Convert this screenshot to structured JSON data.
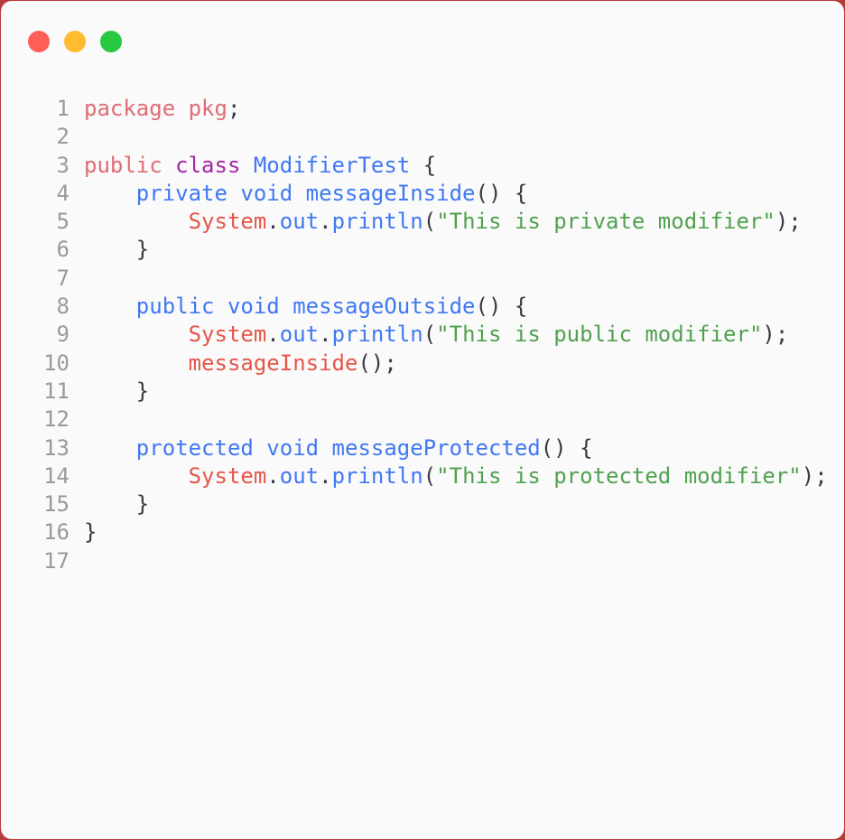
{
  "window": {
    "controls": [
      "close",
      "minimize",
      "maximize"
    ],
    "colors": {
      "background": "#fafafa",
      "close": "#ff5f57",
      "minimize": "#febc2e",
      "maximize": "#28c840"
    }
  },
  "editor": {
    "language": "java",
    "lines": [
      {
        "n": "1",
        "tokens": [
          [
            "kw",
            "package"
          ],
          [
            "pl",
            " "
          ],
          [
            "kw",
            "pkg"
          ],
          [
            "pl",
            ";"
          ]
        ]
      },
      {
        "n": "2",
        "tokens": []
      },
      {
        "n": "3",
        "tokens": [
          [
            "kw",
            "public"
          ],
          [
            "pl",
            " "
          ],
          [
            "kw2",
            "class"
          ],
          [
            "pl",
            " "
          ],
          [
            "ty",
            "ModifierTest"
          ],
          [
            "pl",
            " {"
          ]
        ]
      },
      {
        "n": "4",
        "tokens": [
          [
            "pl",
            "    "
          ],
          [
            "ty",
            "private"
          ],
          [
            "pl",
            " "
          ],
          [
            "ty",
            "void"
          ],
          [
            "pl",
            " "
          ],
          [
            "fn",
            "messageInside"
          ],
          [
            "pl",
            "() {"
          ]
        ]
      },
      {
        "n": "5",
        "tokens": [
          [
            "pl",
            "        "
          ],
          [
            "obj",
            "System"
          ],
          [
            "pl",
            "."
          ],
          [
            "fn",
            "out"
          ],
          [
            "pl",
            "."
          ],
          [
            "fn",
            "println"
          ],
          [
            "pl",
            "("
          ],
          [
            "str",
            "\"This is private modifier\""
          ],
          [
            "pl",
            ");"
          ]
        ]
      },
      {
        "n": "6",
        "tokens": [
          [
            "pl",
            "    }"
          ]
        ]
      },
      {
        "n": "7",
        "tokens": []
      },
      {
        "n": "8",
        "tokens": [
          [
            "pl",
            "    "
          ],
          [
            "ty",
            "public"
          ],
          [
            "pl",
            " "
          ],
          [
            "ty",
            "void"
          ],
          [
            "pl",
            " "
          ],
          [
            "fn",
            "messageOutside"
          ],
          [
            "pl",
            "() {"
          ]
        ]
      },
      {
        "n": "9",
        "tokens": [
          [
            "pl",
            "        "
          ],
          [
            "obj",
            "System"
          ],
          [
            "pl",
            "."
          ],
          [
            "fn",
            "out"
          ],
          [
            "pl",
            "."
          ],
          [
            "fn",
            "println"
          ],
          [
            "pl",
            "("
          ],
          [
            "str",
            "\"This is public modifier\""
          ],
          [
            "pl",
            ");"
          ]
        ]
      },
      {
        "n": "10",
        "tokens": [
          [
            "pl",
            "        "
          ],
          [
            "obj",
            "messageInside"
          ],
          [
            "pl",
            "();"
          ]
        ]
      },
      {
        "n": "11",
        "tokens": [
          [
            "pl",
            "    }"
          ]
        ]
      },
      {
        "n": "12",
        "tokens": []
      },
      {
        "n": "13",
        "tokens": [
          [
            "pl",
            "    "
          ],
          [
            "ty",
            "protected"
          ],
          [
            "pl",
            " "
          ],
          [
            "ty",
            "void"
          ],
          [
            "pl",
            " "
          ],
          [
            "fn",
            "messageProtected"
          ],
          [
            "pl",
            "() {"
          ]
        ]
      },
      {
        "n": "14",
        "tokens": [
          [
            "pl",
            "        "
          ],
          [
            "obj",
            "System"
          ],
          [
            "pl",
            "."
          ],
          [
            "fn",
            "out"
          ],
          [
            "pl",
            "."
          ],
          [
            "fn",
            "println"
          ],
          [
            "pl",
            "("
          ],
          [
            "str",
            "\"This is protected modifier\""
          ],
          [
            "pl",
            ");"
          ]
        ]
      },
      {
        "n": "15",
        "tokens": [
          [
            "pl",
            "    }"
          ]
        ]
      },
      {
        "n": "16",
        "tokens": [
          [
            "pl",
            "}"
          ]
        ]
      },
      {
        "n": "17",
        "tokens": []
      }
    ]
  }
}
